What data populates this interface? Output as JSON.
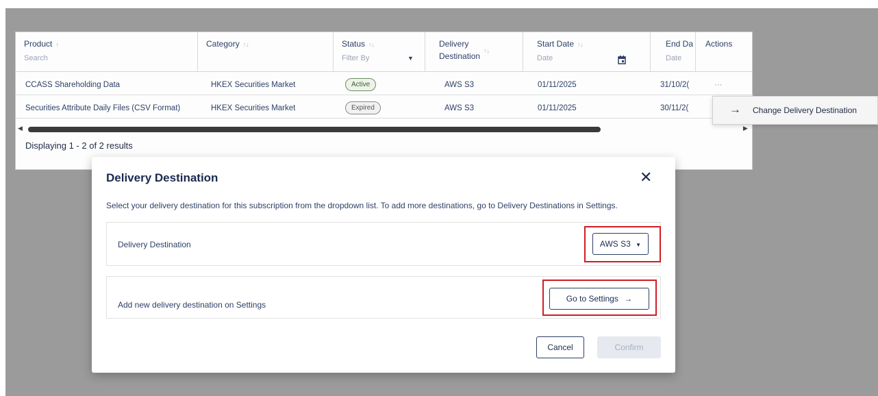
{
  "table": {
    "columns": {
      "product": {
        "label": "Product",
        "sub": "Search",
        "sort": "↑"
      },
      "category": {
        "label": "Category",
        "sort": "↑↓"
      },
      "status": {
        "label": "Status",
        "sub": "Filter By",
        "sort": "↑↓"
      },
      "delivery": {
        "label_line1": "Delivery",
        "label_line2": "Destination",
        "sort": "↑↓"
      },
      "start_date": {
        "label": "Start Date",
        "sub": "Date",
        "sort": "↑↓"
      },
      "end_date": {
        "label": "End Da",
        "sub": "Date"
      },
      "actions": {
        "label": "Actions"
      }
    },
    "rows": [
      {
        "product": "CCASS Shareholding Data",
        "category": "HKEX Securities Market",
        "status": "Active",
        "delivery": "AWS S3",
        "start": "01/11/2025",
        "end": "31/10/2(",
        "actions": "···"
      },
      {
        "product": "Securities Attribute Daily Files (CSV Format)",
        "category": "HKEX Securities Market",
        "status": "Expired",
        "delivery": "AWS S3",
        "start": "01/11/2025",
        "end": "30/11/2("
      }
    ],
    "results_text": "Displaying 1 - 2 of 2 results"
  },
  "context_menu": {
    "item_label": "Change Delivery Destination"
  },
  "modal": {
    "title": "Delivery Destination",
    "description": "Select your delivery destination for this subscription from the dropdown list. To add more destinations, go to Delivery Destinations in Settings.",
    "destination_section": {
      "label": "Delivery Destination",
      "selected_value": "AWS S3"
    },
    "settings_section": {
      "label": "Add new delivery destination on Settings",
      "button_label": "Go to Settings"
    },
    "cancel_label": "Cancel",
    "confirm_label": "Confirm"
  },
  "colors": {
    "highlight": "#d01c24",
    "backdrop": "#9b9b9b",
    "navy": "#1a2a4f"
  }
}
